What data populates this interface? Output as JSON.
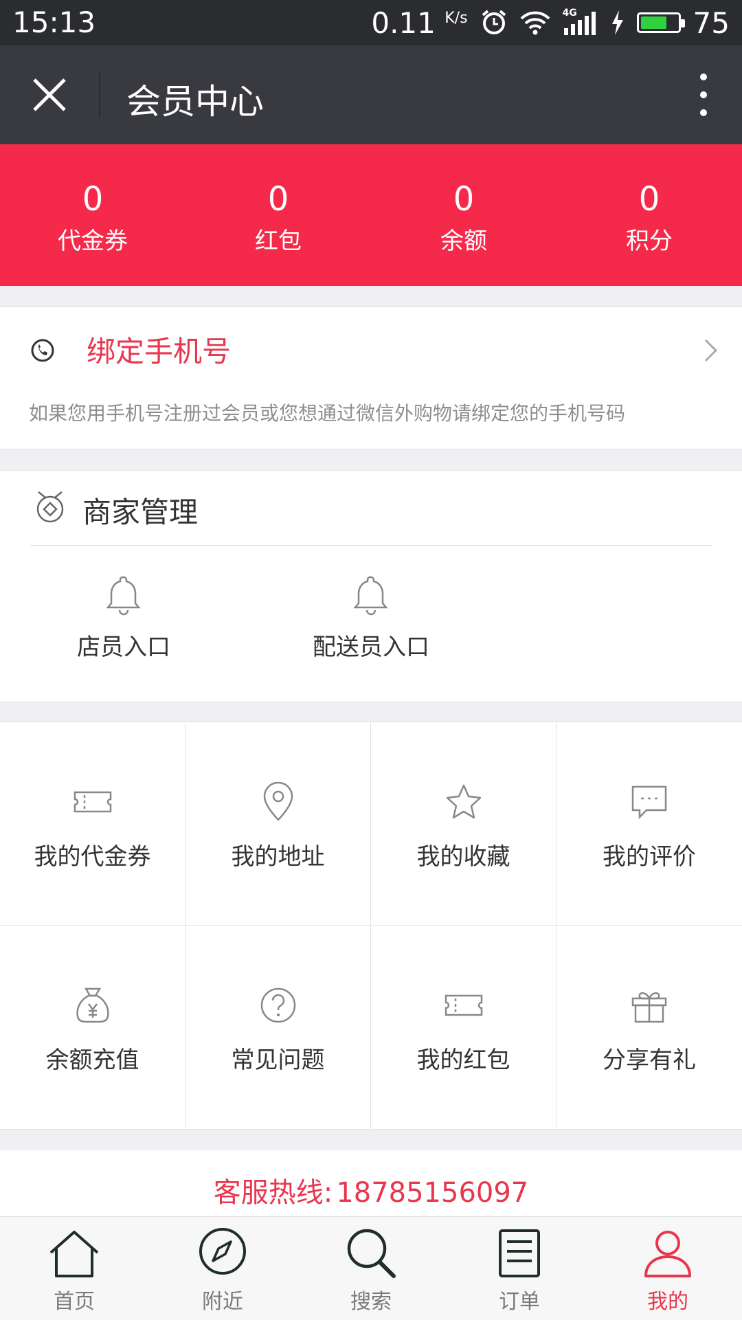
{
  "status_bar": {
    "time": "15:13",
    "speed": "0.11",
    "speed_unit": "K/s",
    "network": "4G",
    "battery": "75",
    "battery_level": 0.75
  },
  "title_bar": {
    "title": "会员中心"
  },
  "stats": [
    {
      "value": "0",
      "label": "代金券"
    },
    {
      "value": "0",
      "label": "红包"
    },
    {
      "value": "0",
      "label": "余额"
    },
    {
      "value": "0",
      "label": "积分"
    }
  ],
  "bind_phone": {
    "title": "绑定手机号",
    "description": "如果您用手机号注册过会员或您想通过微信外购物请绑定您的手机号码"
  },
  "merchant": {
    "title": "商家管理",
    "entries": [
      {
        "label": "店员入口",
        "icon": "bell-icon"
      },
      {
        "label": "配送员入口",
        "icon": "bell-icon"
      }
    ]
  },
  "grid": [
    {
      "label": "我的代金券",
      "icon": "ticket-icon"
    },
    {
      "label": "我的地址",
      "icon": "location-pin-icon"
    },
    {
      "label": "我的收藏",
      "icon": "star-icon"
    },
    {
      "label": "我的评价",
      "icon": "comment-icon"
    },
    {
      "label": "余额充值",
      "icon": "money-bag-icon"
    },
    {
      "label": "常见问题",
      "icon": "question-icon"
    },
    {
      "label": "我的红包",
      "icon": "ticket-icon"
    },
    {
      "label": "分享有礼",
      "icon": "gift-icon"
    }
  ],
  "hotline": {
    "label": "客服热线:",
    "number": "18785156097"
  },
  "bottom_nav": [
    {
      "label": "首页",
      "icon": "home-icon",
      "active": false
    },
    {
      "label": "附近",
      "icon": "compass-icon",
      "active": false
    },
    {
      "label": "搜索",
      "icon": "search-icon",
      "active": false
    },
    {
      "label": "订单",
      "icon": "order-list-icon",
      "active": false
    },
    {
      "label": "我的",
      "icon": "user-icon",
      "active": true
    }
  ],
  "colors": {
    "accent": "#f52a4b",
    "accent_text": "#e8364e",
    "titlebar": "#393a3f",
    "statusbar": "#2b2c30"
  }
}
